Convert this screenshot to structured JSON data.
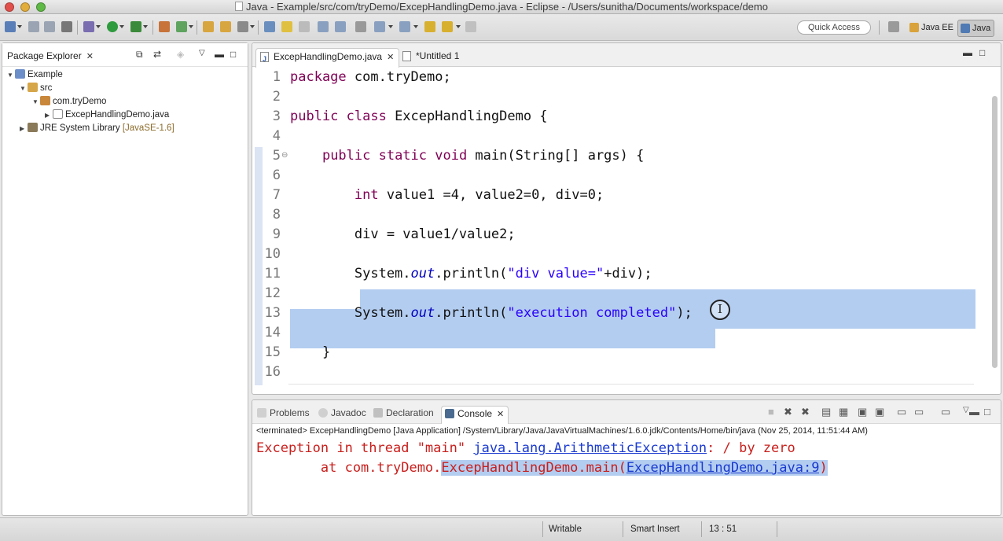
{
  "window": {
    "title": "Java - Example/src/com/tryDemo/ExcepHandlingDemo.java - Eclipse - /Users/sunitha/Documents/workspace/demo"
  },
  "toolbar": {
    "quick_access": "Quick Access",
    "perspectives": [
      "Java EE",
      "Java"
    ]
  },
  "package_explorer": {
    "title": "Package Explorer",
    "tree": [
      {
        "label": "Example",
        "depth": 0,
        "expanded": true,
        "icon": "project-icon"
      },
      {
        "label": "src",
        "depth": 1,
        "expanded": true,
        "icon": "source-folder-icon"
      },
      {
        "label": "com.tryDemo",
        "depth": 2,
        "expanded": true,
        "icon": "package-icon"
      },
      {
        "label": "ExcepHandlingDemo.java",
        "depth": 3,
        "expanded": false,
        "icon": "java-file-icon"
      },
      {
        "label": "JRE System Library",
        "decoration": "[JavaSE-1.6]",
        "depth": 0,
        "expanded": false,
        "icon": "library-icon"
      }
    ]
  },
  "editor": {
    "tabs": [
      {
        "label": "ExcepHandlingDemo.java",
        "active": true
      },
      {
        "label": "*Untitled 1",
        "active": false
      }
    ],
    "lines": [
      {
        "n": "1",
        "text": "package com.tryDemo;"
      },
      {
        "n": "2",
        "text": ""
      },
      {
        "n": "3",
        "text": "public class ExcepHandlingDemo {"
      },
      {
        "n": "4",
        "text": ""
      },
      {
        "n": "5",
        "text": "    public static void main(String[] args) {"
      },
      {
        "n": "6",
        "text": ""
      },
      {
        "n": "7",
        "text": "        int value1 =4, value2=0, div=0;"
      },
      {
        "n": "8",
        "text": ""
      },
      {
        "n": "9",
        "text": "        div = value1/value2;"
      },
      {
        "n": "10",
        "text": ""
      },
      {
        "n": "11",
        "text": "        System.out.println(\"div value=\"+div);"
      },
      {
        "n": "12",
        "text": ""
      },
      {
        "n": "13",
        "text": "        System.out.println(\"execution completed\");"
      },
      {
        "n": "14",
        "text": ""
      },
      {
        "n": "15",
        "text": "    }"
      },
      {
        "n": "16",
        "text": ""
      }
    ]
  },
  "console": {
    "tabs": [
      {
        "label": "Problems",
        "icon": "problems-icon"
      },
      {
        "label": "Javadoc",
        "icon": "javadoc-icon"
      },
      {
        "label": "Declaration",
        "icon": "declaration-icon"
      },
      {
        "label": "Console",
        "icon": "console-icon",
        "active": true
      }
    ],
    "terminated": "<terminated> ExcepHandlingDemo [Java Application] /System/Library/Java/JavaVirtualMachines/1.6.0.jdk/Contents/Home/bin/java (Nov 25, 2014, 11:51:44 AM)",
    "line1_prefix": "Exception in thread \"main\" ",
    "line1_link": "java.lang.ArithmeticException",
    "line1_suffix": ": / by zero",
    "line2_prefix": "        at com.tryDemo.",
    "line2_highlight": "ExcepHandlingDemo.main(",
    "line2_link": "ExcepHandlingDemo.java:9",
    "line2_suffix": ")"
  },
  "statusbar": {
    "writable": "Writable",
    "insert_mode": "Smart Insert",
    "position": "13 : 51"
  },
  "colors": {
    "keyword": "#7f0055",
    "string": "#2a00ff",
    "selection": "#b3cdf0",
    "error": "#c8201d",
    "link": "#1a3ad0"
  }
}
